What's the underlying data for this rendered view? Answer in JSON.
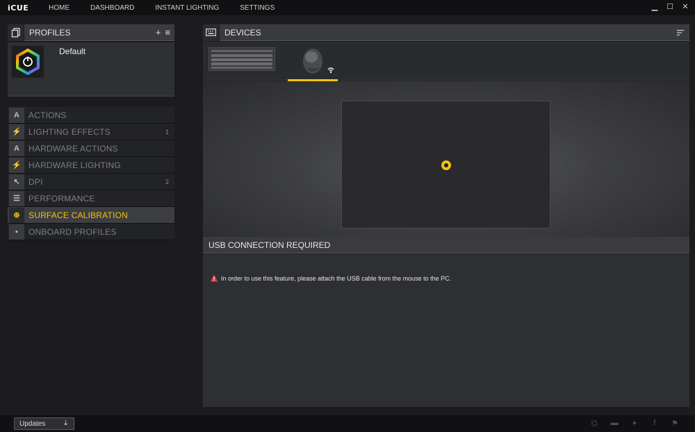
{
  "app": {
    "logo": "iCUE"
  },
  "nav": [
    {
      "label": "HOME"
    },
    {
      "label": "DASHBOARD"
    },
    {
      "label": "INSTANT LIGHTING"
    },
    {
      "label": "SETTINGS"
    }
  ],
  "window": {
    "minimize": "▁",
    "maximize": "☐",
    "close": "✕"
  },
  "profiles": {
    "title": "PROFILES",
    "add": "+",
    "menu": "≡",
    "default_profile": "Default"
  },
  "menu": [
    {
      "label": "ACTIONS",
      "icon": "A",
      "count": ""
    },
    {
      "label": "LIGHTING EFFECTS",
      "icon": "⚡",
      "count": "1"
    },
    {
      "label": "HARDWARE ACTIONS",
      "icon": "A",
      "count": ""
    },
    {
      "label": "HARDWARE LIGHTING",
      "icon": "⚡",
      "count": ""
    },
    {
      "label": "DPI",
      "icon": "↖",
      "count": "2"
    },
    {
      "label": "PERFORMANCE",
      "icon": "☰",
      "count": ""
    },
    {
      "label": "SURFACE CALIBRATION",
      "icon": "⊕",
      "count": ""
    },
    {
      "label": "ONBOARD PROFILES",
      "icon": "▪",
      "count": ""
    }
  ],
  "devices": {
    "title": "DEVICES"
  },
  "usb": {
    "title": "USB CONNECTION REQUIRED",
    "message": "In order to use this feature, please attach the USB cable from the mouse to the PC."
  },
  "bottom": {
    "updates": "Updates",
    "download_glyph": "⤓"
  },
  "social": {
    "forum": "⌬",
    "chat": "▬",
    "twitter": "✦",
    "facebook": "f",
    "corsair": "⚑"
  },
  "colors": {
    "accent": "#f2c20f",
    "warning": "#e23b3b"
  }
}
